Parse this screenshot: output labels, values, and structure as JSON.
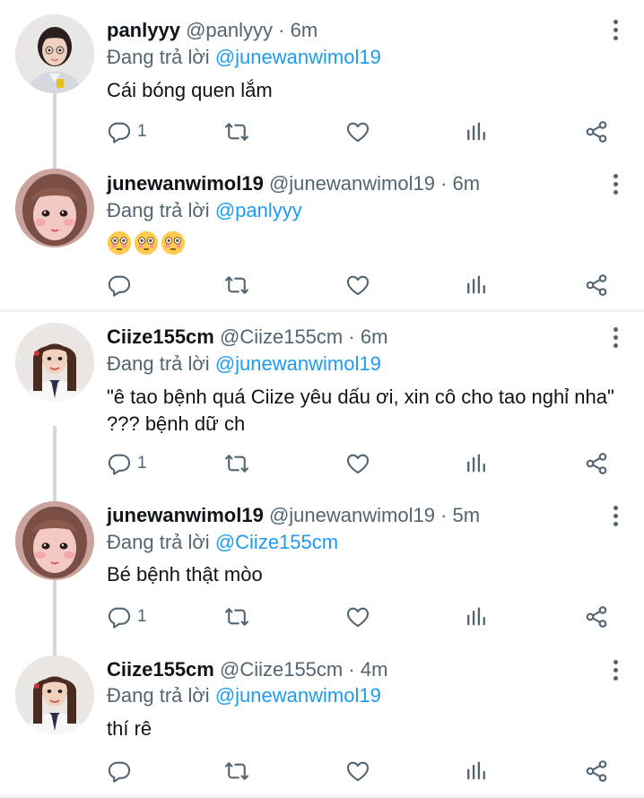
{
  "reply_prefix": "Đang trả lời",
  "tweets": [
    {
      "name": "panlyyy",
      "handle": "@panlyyy",
      "dot": "·",
      "time": "6m",
      "reply_to": "@junewanwimol19",
      "text": "Cái bóng quen lắm",
      "reply_count": "1"
    },
    {
      "name": "junewanwimol19",
      "handle": "@junewanwimol19",
      "dot": "·",
      "time": "6m",
      "reply_to": "@panlyyy",
      "text": "😳😳😳",
      "reply_count": ""
    },
    {
      "name": "Ciize155cm",
      "handle": "@Ciize155cm",
      "dot": "·",
      "time": "6m",
      "reply_to": "@junewanwimol19",
      "text": "\"ê tao bệnh quá Ciize yêu dấu ơi, xin cô cho tao nghỉ nha\" ??? bệnh dữ ch",
      "reply_count": "1"
    },
    {
      "name": "junewanwimol19",
      "handle": "@junewanwimol19",
      "dot": "·",
      "time": "5m",
      "reply_to": "@Ciize155cm",
      "text": "Bé bệnh thật mòo",
      "reply_count": "1"
    },
    {
      "name": "Ciize155cm",
      "handle": "@Ciize155cm",
      "dot": "·",
      "time": "4m",
      "reply_to": "@junewanwimol19",
      "text": "thí rê",
      "reply_count": ""
    }
  ],
  "icons": {
    "reply": "reply-icon",
    "retweet": "retweet-icon",
    "like": "heart-icon",
    "stats": "stats-icon",
    "share": "share-icon",
    "more": "more-options-icon",
    "emoji": "flushed-face-emoji"
  },
  "colors": {
    "accent": "#1d9bf0",
    "secondary_text": "#536471",
    "thread_line": "#cfd9de"
  }
}
